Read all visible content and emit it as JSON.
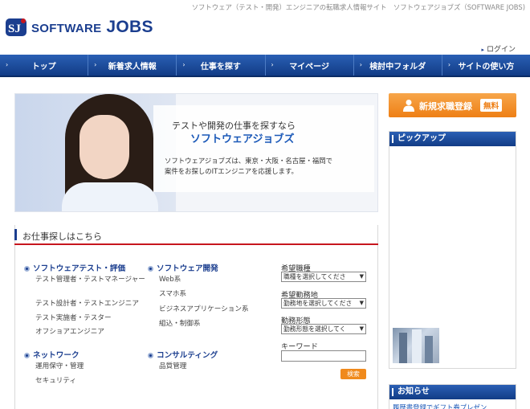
{
  "header": {
    "tagline": "ソフトウェア（テスト・開発）エンジニアの転職求人情報サイト　ソフトウェアジョブズ（SOFTWARE JOBS)",
    "logo_software": "SOFTWARE",
    "logo_jobs": "JOBS",
    "login": "ログイン"
  },
  "nav": {
    "items": [
      {
        "label": "トップ"
      },
      {
        "label": "新着求人情報"
      },
      {
        "label": "仕事を探す"
      },
      {
        "label": "マイページ"
      },
      {
        "label": "検討中フォルダ"
      },
      {
        "label": "サイトの使い方"
      }
    ]
  },
  "hero": {
    "title": "テストや開発の仕事を探すなら",
    "subtitle": "ソフトウェアジョブズ",
    "desc_line1": "ソフトウェアジョブズは、東京・大阪・名古屋・福岡で",
    "desc_line2": "案件をお探しのITエンジニアを応援します。"
  },
  "search": {
    "title": "お仕事探しはこちら",
    "categories": [
      {
        "label": "ソフトウェアテスト・評価",
        "items": [
          "テスト管理者・テストマネージャー",
          "テスト設計者・テストエンジニア",
          "テスト実施者・テスター",
          "オフショアエンジニア"
        ]
      },
      {
        "label": "ソフトウェア開発",
        "items": [
          "Web系",
          "スマホ系",
          "ビジネスアプリケーション系",
          "組込・制御系"
        ]
      },
      {
        "label": "ネットワーク",
        "items": [
          "運用保守・管理",
          "セキュリティ"
        ]
      },
      {
        "label": "コンサルティング",
        "items": [
          "品質管理"
        ]
      }
    ],
    "form": {
      "job_label": "希望職種",
      "job_value": "職種を選択してくださ",
      "area_label": "希望勤務地",
      "area_value": "勤務地を選択してくださ",
      "type_label": "勤務形態",
      "type_value": "勤務形態を選択してく",
      "keyword_label": "キーワード",
      "keyword_value": "",
      "button": "検索"
    }
  },
  "sidebar": {
    "register_label": "新規求職登録",
    "free_badge": "無料",
    "pickup_title": "ピックアップ",
    "news_title": "お知らせ",
    "news_item": "履歴書登録でギフト券プレゼン"
  },
  "colors": {
    "brand_blue": "#1b3e8f",
    "nav_blue": "#1f4fa0",
    "accent_orange": "#ee7f15",
    "accent_red": "#c7161e"
  }
}
